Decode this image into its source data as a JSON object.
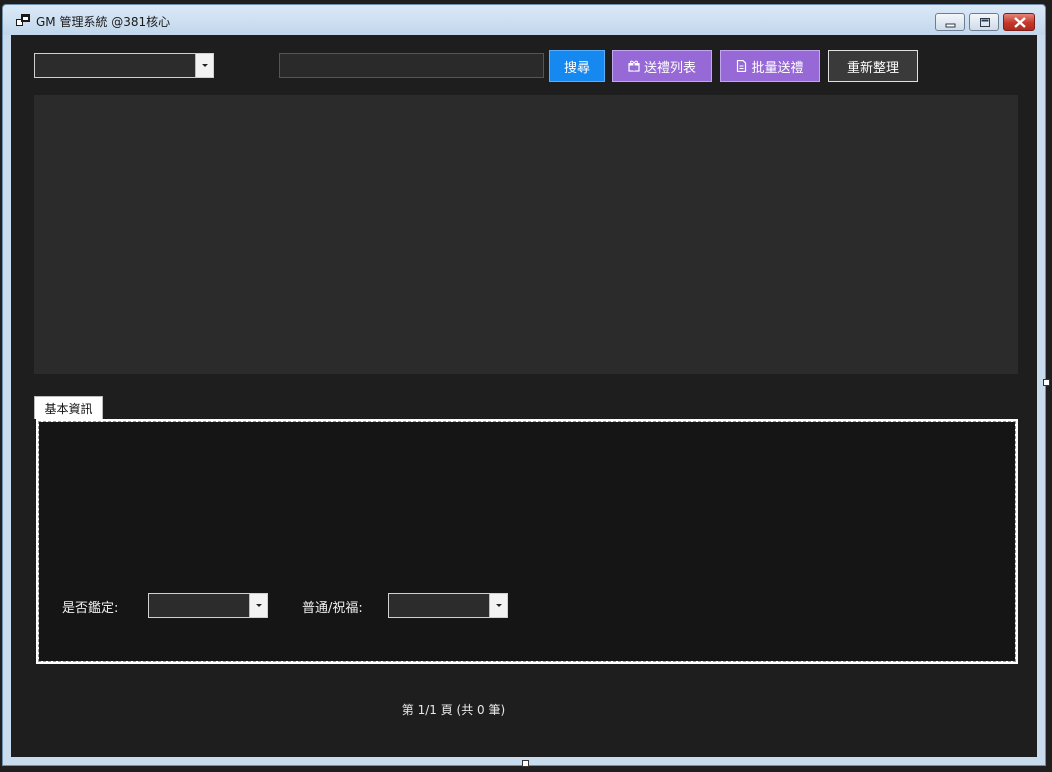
{
  "window": {
    "title": "GM 管理系統 @381核心",
    "icons": {
      "app": "app-window-icon",
      "minimize": "minimize-icon",
      "maximize": "maximize-icon",
      "close": "close-icon"
    }
  },
  "toolbar": {
    "category_select": {
      "selected": ""
    },
    "search_input": {
      "value": "",
      "placeholder": ""
    },
    "search_label": "搜尋",
    "gift_list_label": "送禮列表",
    "batch_gift_label": "批量送禮",
    "refresh_label": "重新整理",
    "colors": {
      "search": "#1589f0",
      "gift": "#9669d7",
      "refresh": "#3a3a3a"
    },
    "button_icons": {
      "gift_list": "gift-icon",
      "batch_gift": "document-icon"
    }
  },
  "tabs": [
    {
      "label": "基本資訊",
      "active": true
    }
  ],
  "basic_info": {
    "appraised_label": "是否鑑定:",
    "appraised_selected": "",
    "blessing_label": "普通/祝福:",
    "blessing_selected": ""
  },
  "pager": {
    "text": "第 1/1 頁 (共 0 筆)"
  }
}
